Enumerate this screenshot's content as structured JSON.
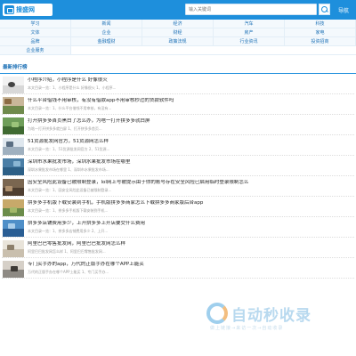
{
  "header": {
    "logo_text": "搜盛网",
    "search_placeholder": "输入关键词",
    "nav_label": "导航"
  },
  "categories": [
    "学习",
    "新闻",
    "经济",
    "汽车",
    "科技",
    "文体",
    "企业",
    "财经",
    "房产",
    "家电",
    "品牌",
    "金融理财",
    "政策法规",
    "行业资讯",
    "投资招商",
    "企业服务"
  ],
  "section": {
    "title": "最新排行榜"
  },
  "articles": [
    {
      "title": "小程序介绍，小程序是什么 好像很火",
      "desc": "本文目录一览：1、小程序是什么 好像很火 1、小程序..."
    },
    {
      "title": "什么平台借钱不用审核，有没有借款app不用审核秒过的贷款软件吗",
      "desc": "本文目录一览：1、什么平台借钱不用审核，有没有..."
    },
    {
      "title": "打开拼多多首页黑白了怎么办，为啥一打开拼多多就白屏",
      "desc": "为啥一打开拼多多就白屏 1、打开拼多多首页..."
    },
    {
      "title": "51货源批发网官方，51货源网怎么样",
      "desc": "本文目录一览：1、51货源批发网官方 2、51货源..."
    },
    {
      "title": "深圳市水果批发市场，深圳水果批发市场在哪里",
      "desc": "深圳水果批发市场在哪里 1、深圳市水果批发市场..."
    },
    {
      "title": "因安全风险此设备已被限制登录，lol网上号被提示由于你的账号存在安全风险已启用临时登录限制怎么",
      "desc": "本文目录一览：1、因安全风险此设备已被限制登录..."
    },
    {
      "title": "拼多多手机版下载安装到手机，手机版拼多多商家怎么下载拼多多商家版后台app",
      "desc": "本文目录一览：1、拼多多手机版下载安装到手机..."
    },
    {
      "title": "拼多多店铺费用多少，上开拼多多上开店要交什么费用",
      "desc": "本文目录一览：1、拼多多店铺费用多少 2、上开..."
    },
    {
      "title": "阿里巴巴零售批发网，阿里巴巴批发网怎么样",
      "desc": "阿里巴巴批发网怎么样 1、阿里巴巴零售批发网..."
    },
    {
      "title": "专门买手办的app，万代的正版手办在哪个APP上能买",
      "desc": "万代的正版手办在哪个APP上能买 1、专门买手办..."
    }
  ],
  "watermark": {
    "text": "自动秒收录",
    "sub": "做上链接→来访一次→自动收录"
  },
  "colors": {
    "brand": "#1e8fdc",
    "link": "#1a6fb5"
  }
}
